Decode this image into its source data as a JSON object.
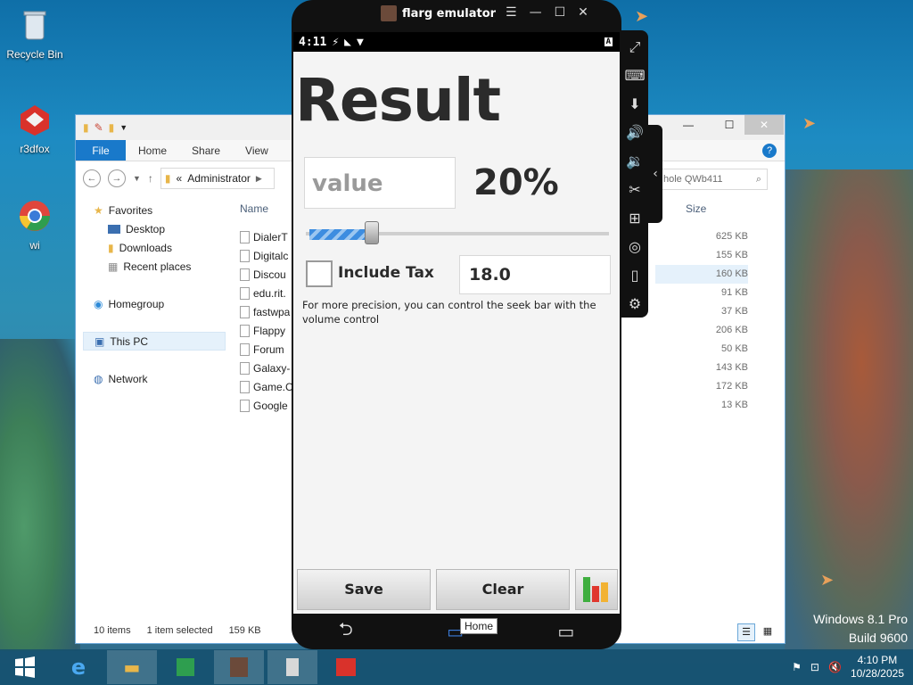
{
  "desktop": {
    "icons": [
      {
        "label": "Recycle Bin"
      },
      {
        "label": "r3dfox"
      },
      {
        "label": "wi"
      }
    ],
    "watermark": {
      "line1": "Windows 8.1 Pro",
      "line2": "Build 9600"
    }
  },
  "explorer": {
    "ribbon_tabs": [
      "File",
      "Home",
      "Share",
      "View"
    ],
    "address": "Administrator",
    "address_prefix": "«",
    "search_placeholder": "hole QWb411",
    "nav": {
      "favorites": "Favorites",
      "desktop": "Desktop",
      "downloads": "Downloads",
      "recent": "Recent places",
      "homegroup": "Homegroup",
      "thispc": "This PC",
      "network": "Network"
    },
    "columns": {
      "name": "Name",
      "size": "Size"
    },
    "files": [
      {
        "name": "DialerT",
        "size": "625 KB"
      },
      {
        "name": "Digitalc",
        "size": "155 KB"
      },
      {
        "name": "Discou",
        "size": "160 KB"
      },
      {
        "name": "edu.rit.",
        "size": "91 KB"
      },
      {
        "name": "fastwpa",
        "size": "37 KB"
      },
      {
        "name": "Flappy",
        "size": "206 KB"
      },
      {
        "name": "Forum",
        "size": "50 KB"
      },
      {
        "name": "Galaxy-",
        "size": "143 KB"
      },
      {
        "name": "Game.C",
        "size": "172 KB"
      },
      {
        "name": "Google",
        "size": "13 KB"
      }
    ],
    "status": {
      "items": "10 items",
      "selected": "1 item selected",
      "size": "159 KB"
    }
  },
  "emulator": {
    "title": "flarg emulator",
    "status_time": "4:11",
    "app": {
      "title": "Result",
      "value_placeholder": "value",
      "percent": "20%",
      "seek_fraction": 0.2,
      "include_tax_label": "Include Tax",
      "tax_value": "18.0",
      "hint": "For more precision, you can control the seek bar with the volume control",
      "save_label": "Save",
      "clear_label": "Clear"
    },
    "tooltip": "Home"
  },
  "taskbar": {
    "time": "4:10 PM",
    "date": "10/28/2025"
  }
}
